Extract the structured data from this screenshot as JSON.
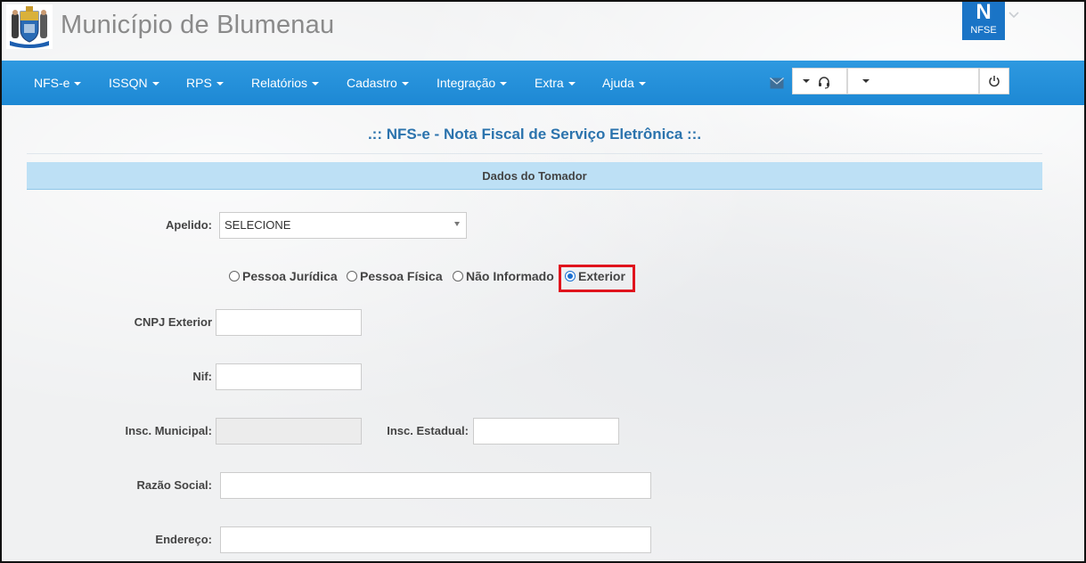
{
  "header": {
    "title": "Município de Blumenau",
    "badge_big": "N",
    "badge_small": "NFSE"
  },
  "nav": {
    "items": [
      "NFS-e",
      "ISSQN",
      "RPS",
      "Relatórios",
      "Cadastro",
      "Integração",
      "Extra",
      "Ajuda"
    ]
  },
  "page": {
    "heading": ".:: NFS-e - Nota Fiscal de Serviço Eletrônica ::.",
    "section": "Dados do Tomador"
  },
  "form": {
    "apelido_label": "Apelido:",
    "apelido_value": "SELECIONE",
    "radio_options": [
      "Pessoa Jurídica",
      "Pessoa Física",
      "Não Informado",
      "Exterior"
    ],
    "radio_selected": "Exterior",
    "cnpj_label": "CNPJ Exterior",
    "nif_label": "Nif:",
    "insc_municipal_label": "Insc. Municipal:",
    "insc_estadual_label": "Insc. Estadual:",
    "razao_label": "Razão Social:",
    "endereco_label": "Endereço:"
  },
  "colors": {
    "navbar": "#1d88d4",
    "heading": "#2b73ad",
    "section_bar": "#bde0f5",
    "highlight": "#e0141d",
    "badge": "#1a74c6"
  }
}
